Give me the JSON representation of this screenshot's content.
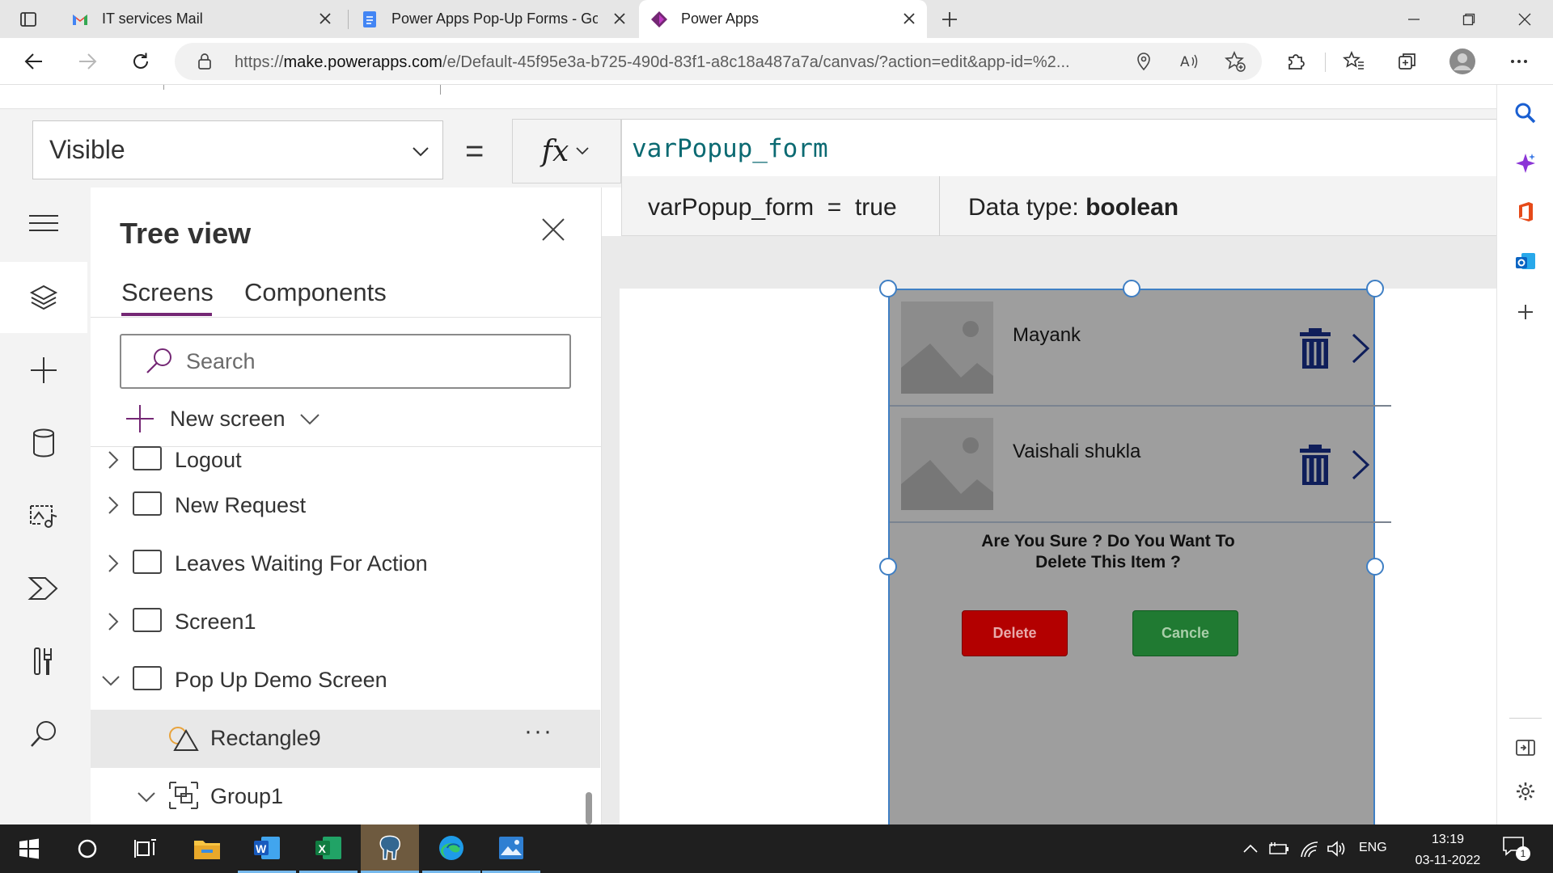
{
  "browser": {
    "tabs": [
      {
        "title": "IT services Mail",
        "icon": "gmail-icon"
      },
      {
        "title": "Power Apps Pop-Up Forms - Goo",
        "icon": "google-docs-icon"
      },
      {
        "title": "Power Apps",
        "icon": "power-apps-icon",
        "active": true
      }
    ],
    "url_prefix": "https://",
    "url_host": "make.powerapps.com",
    "url_path": "/e/Default-45f95e3a-b725-490d-83f1-a8c18a487a7a/canvas/?action=edit&app-id=%2..."
  },
  "formula_bar": {
    "property": "Visible",
    "equals": "=",
    "fx": "fx",
    "formula": "varPopup_form",
    "result_expression": "varPopup_form  =  true",
    "data_type_label": "Data type:",
    "data_type_value": "boolean"
  },
  "tree_view": {
    "title": "Tree view",
    "tabs": [
      "Screens",
      "Components"
    ],
    "active_tab": "Screens",
    "search_placeholder": "Search",
    "new_screen_label": "New screen",
    "items": [
      {
        "label": "Logout",
        "type": "screen",
        "expanded": false
      },
      {
        "label": "New Request",
        "type": "screen",
        "expanded": false
      },
      {
        "label": "Leaves Waiting For Action",
        "type": "screen",
        "expanded": false
      },
      {
        "label": "Screen1",
        "type": "screen",
        "expanded": false
      },
      {
        "label": "Pop Up Demo Screen",
        "type": "screen",
        "expanded": true
      },
      {
        "label": "Rectangle9",
        "type": "shape",
        "selected": true,
        "more": "···"
      },
      {
        "label": "Group1",
        "type": "group",
        "expanded": true
      }
    ]
  },
  "canvas": {
    "gallery": [
      {
        "name": "Mayank"
      },
      {
        "name": "Vaishali shukla"
      }
    ],
    "confirm_text": "Are You Sure ? Do You Want To Delete This Item ?",
    "delete_label": "Delete",
    "cancel_label": "Cancle",
    "colors": {
      "delete": "#b30000",
      "cancel": "#207a32",
      "overlay": "#9e9e9e",
      "selection": "#3f7fc4"
    }
  },
  "taskbar": {
    "language": "ENG",
    "time": "13:19",
    "date": "03-11-2022",
    "notification_count": "1"
  }
}
